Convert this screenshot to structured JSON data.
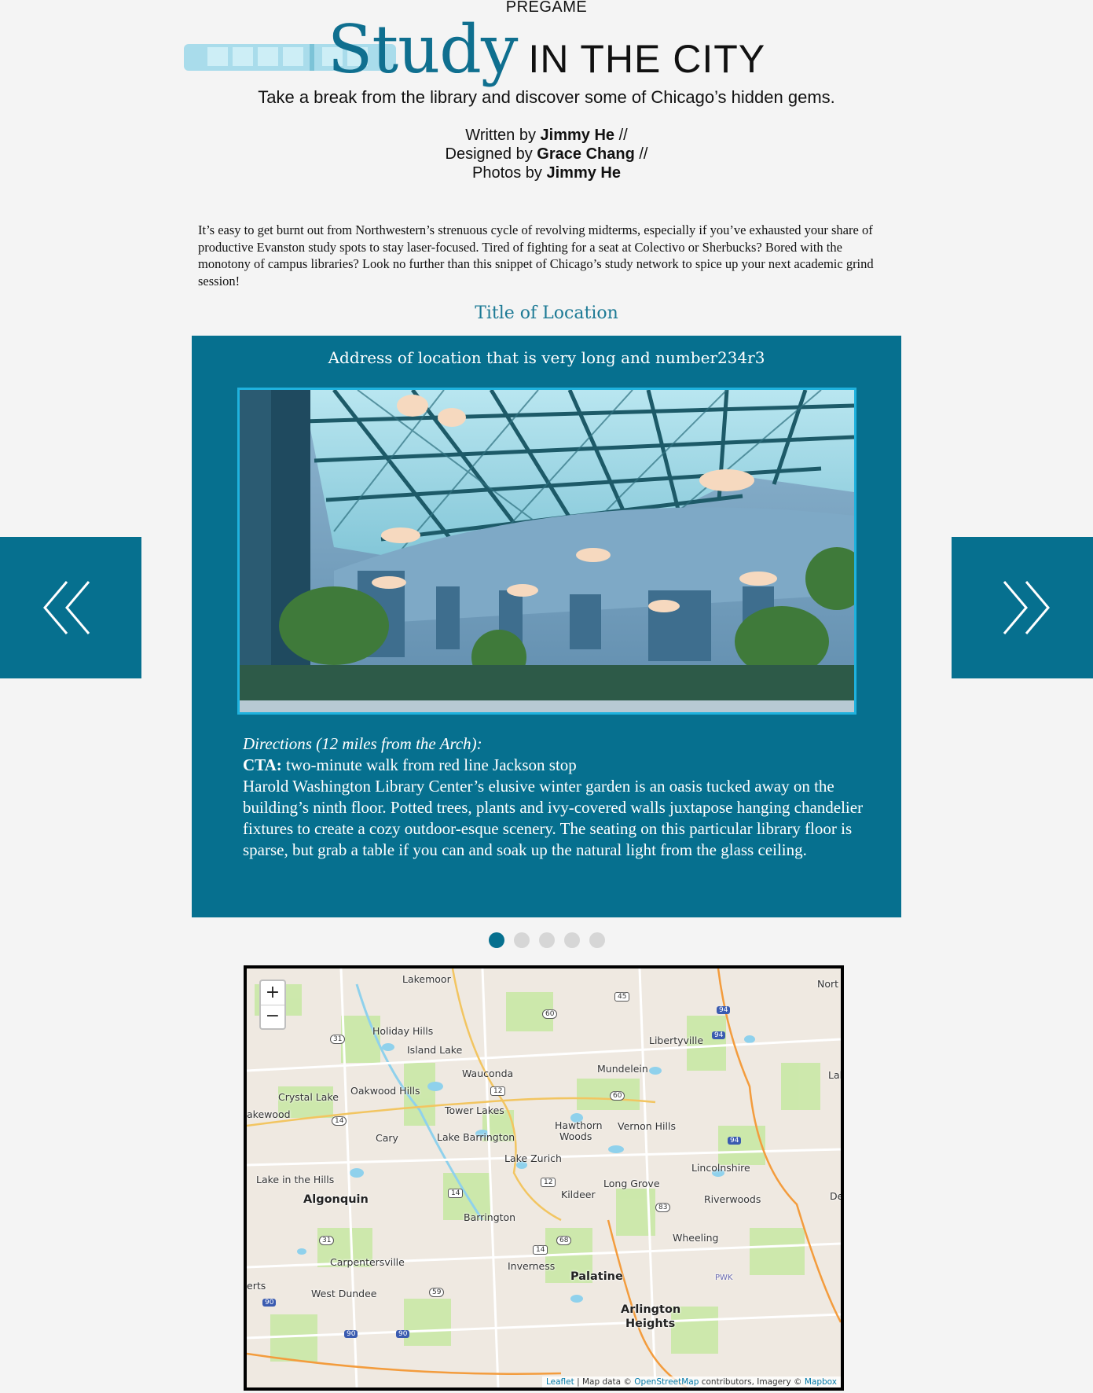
{
  "header": {
    "kicker": "PREGAME",
    "title_study": "Study",
    "title_rest": "IN THE CITY",
    "subtitle": "Take a break from the library and discover some of Chicago’s hidden gems."
  },
  "credits": [
    {
      "prefix": "Written by ",
      "name": "Jimmy He",
      "suffix": " //"
    },
    {
      "prefix": "Designed by ",
      "name": "Grace Chang",
      "suffix": " //"
    },
    {
      "prefix": "Photos by ",
      "name": "Jimmy He",
      "suffix": ""
    }
  ],
  "intro": "It’s easy to get burnt out from Northwestern’s strenuous cycle of revolving midterms, especially if you’ve exhausted your share of productive Evanston study spots to stay laser-focused. Tired of fighting for a seat at Colectivo or Sherbucks? Bored with the monotony of campus libraries? Look no further than this snippet of Chicago’s study network to spice up your next academic grind session!",
  "location": {
    "title": "Title of Location",
    "address": "Address of location that is very long and number234r3",
    "directions_heading": "Directions (12 miles from the Arch):",
    "cta_label": "CTA:",
    "cta_text": " two-minute walk from red line Jackson stop",
    "description": "Harold Washington Library Center’s elusive winter garden is an oasis tucked away on the building’s ninth floor. Potted trees, plants and ivy-covered walls juxtapose hanging chandelier fixtures to create a cozy outdoor-esque scenery. The seating on this particular library floor is sparse, but grab a table if you can and soak up the natural light from the glass ceiling."
  },
  "carousel": {
    "prev_icon": "double-chevron-left-icon",
    "next_icon": "double-chevron-right-icon",
    "slide_count": 5,
    "active_index": 0
  },
  "colors": {
    "accent": "#06708f",
    "photo_border": "#1fb2de",
    "dot_inactive": "#d6d6d6",
    "page_bg": "#f4f4f4"
  },
  "map": {
    "zoom_in": "+",
    "zoom_out": "−",
    "labels": [
      "Lakemoor",
      "Holiday Hills",
      "Island Lake",
      "Wauconda",
      "Crystal Lake",
      "Oakwood Hills",
      "akewood",
      "Tower Lakes",
      "Cary",
      "Lake Barrington",
      "Mundelein",
      "Libertyville",
      "Hawthorn",
      "Woods",
      "Vernon Hills",
      "Lake Zurich",
      "Lincolnshire",
      "Lake in the Hills",
      "Algonquin",
      "Kildeer",
      "Long Grove",
      "Riverwoods",
      "Barrington",
      "Wheeling",
      "Carpentersville",
      "Inverness",
      "Palatine",
      "West Dundee",
      "Arlington",
      "Heights",
      "Nort",
      "Lak",
      "De",
      "erts",
      "PWK"
    ],
    "shields": [
      "60",
      "45",
      "31",
      "12",
      "60",
      "14",
      "14",
      "12",
      "83",
      "31",
      "68",
      "14",
      "59"
    ],
    "interstates": [
      "94",
      "94",
      "94",
      "90",
      "90",
      "90"
    ],
    "attribution": {
      "leaflet": "Leaflet",
      "text1": " | Map data © ",
      "osm": "OpenStreetMap",
      "text2": " contributors, Imagery © ",
      "mapbox": "Mapbox"
    }
  }
}
